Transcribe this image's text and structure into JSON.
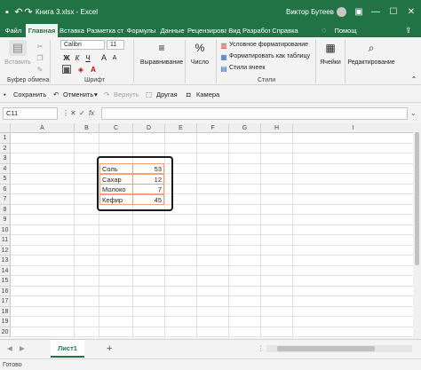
{
  "window": {
    "title": "Книга 3.xlsx  -  Excel",
    "user": "Виктор Бутеев",
    "controls": {
      "minimize": "—",
      "maximize": "☐",
      "close": "✕",
      "ribbon_display": "▣"
    }
  },
  "quick_access": {
    "save_icon": "💾",
    "undo_icon": "↶",
    "redo_icon": "↷"
  },
  "tabs": [
    {
      "label": "Файл",
      "active": false
    },
    {
      "label": "Главная",
      "active": true
    },
    {
      "label": "Вставка",
      "active": false
    },
    {
      "label": "Разметка ст",
      "active": false
    },
    {
      "label": "Формулы",
      "active": false
    },
    {
      "label": "Данные",
      "active": false
    },
    {
      "label": "Рецензирова",
      "active": false
    },
    {
      "label": "Вид",
      "active": false
    },
    {
      "label": "Разработчи",
      "active": false
    },
    {
      "label": "Справка",
      "active": false
    }
  ],
  "tell_me": {
    "icon": "lightbulb-icon",
    "label": "Помощ"
  },
  "share_icon": "share-icon",
  "ribbon": {
    "clipboard": {
      "paste": "Вставить",
      "group": "Буфер обмена"
    },
    "font": {
      "name": "Calibri",
      "size": "11",
      "grow": "A",
      "shrink": "A",
      "bold": "Ж",
      "italic": "К",
      "underline": "Ч",
      "group": "Шрифт"
    },
    "alignment": {
      "label": "Выравнивание"
    },
    "number": {
      "label": "Число"
    },
    "styles": {
      "conditional": "Условное форматирование",
      "as_table": "Форматировать как таблицу",
      "cell_styles": "Стили ячеек",
      "group": "Стили"
    },
    "cells": {
      "label": "Ячейки"
    },
    "editing": {
      "label": "Редактирование"
    }
  },
  "qat_bar": {
    "save": "Сохранить",
    "undo": "Отменить",
    "redo": "Вернуть",
    "other": "Другая",
    "camera": "Камера"
  },
  "formula_bar": {
    "name_box": "C11",
    "cancel": "✕",
    "enter": "✓",
    "fx": "fx",
    "value": ""
  },
  "columns": [
    "A",
    "B",
    "C",
    "D",
    "E",
    "F",
    "G",
    "H",
    "I"
  ],
  "rows": [
    "1",
    "2",
    "3",
    "4",
    "5",
    "6",
    "7",
    "8",
    "9",
    "10",
    "11",
    "12",
    "13",
    "14",
    "15",
    "16",
    "17",
    "18",
    "19",
    "20"
  ],
  "table": [
    {
      "name": "Соль",
      "value": "53"
    },
    {
      "name": "Сахар",
      "value": "12"
    },
    {
      "name": "Молоко",
      "value": "7"
    },
    {
      "name": "Кефир",
      "value": "45"
    }
  ],
  "sheets": [
    {
      "label": "Лист1",
      "active": true
    }
  ],
  "add_sheet": "+",
  "status": "Готово"
}
